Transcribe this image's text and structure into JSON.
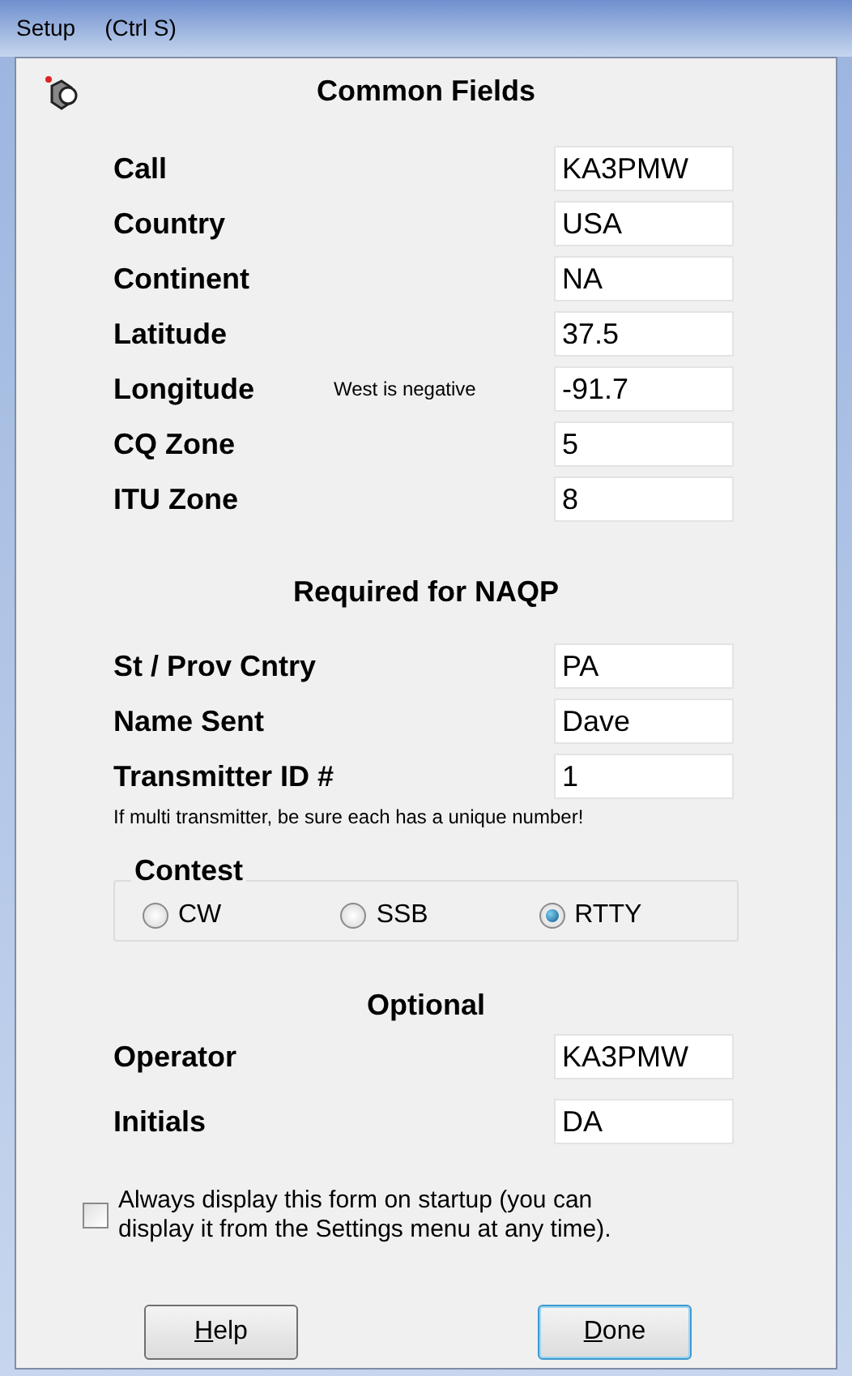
{
  "window": {
    "title": "Setup",
    "shortcut": "(Ctrl S)"
  },
  "common": {
    "title": "Common Fields",
    "fields": [
      {
        "label": "Call",
        "value": "KA3PMW"
      },
      {
        "label": "Country",
        "value": "USA"
      },
      {
        "label": "Continent",
        "value": "NA"
      },
      {
        "label": "Latitude",
        "value": "37.5"
      },
      {
        "label": "Longitude",
        "note": "West is negative",
        "value": "-91.7"
      },
      {
        "label": "CQ Zone",
        "value": "5"
      },
      {
        "label": "ITU Zone",
        "value": "8"
      }
    ]
  },
  "naqp": {
    "title": "Required for NAQP",
    "fields": [
      {
        "label": "St / Prov Cntry",
        "value": "PA"
      },
      {
        "label": "Name Sent",
        "value": "Dave"
      },
      {
        "label": "Transmitter ID #",
        "value": "1"
      }
    ],
    "note": "If multi transmitter, be sure each has a unique number!"
  },
  "contest": {
    "title": "Contest",
    "options": [
      {
        "label": "CW",
        "selected": false
      },
      {
        "label": "SSB",
        "selected": false
      },
      {
        "label": "RTTY",
        "selected": true
      }
    ]
  },
  "optional": {
    "title": "Optional",
    "fields": [
      {
        "label": "Operator",
        "value": "KA3PMW"
      },
      {
        "label": "Initials",
        "value": "DA"
      }
    ]
  },
  "startup": {
    "label": "Always display this form on startup (you can display it from the Settings menu at any time).",
    "checked": false
  },
  "buttons": [
    {
      "label": "Help",
      "default": false
    },
    {
      "label": "Done",
      "default": true
    }
  ]
}
